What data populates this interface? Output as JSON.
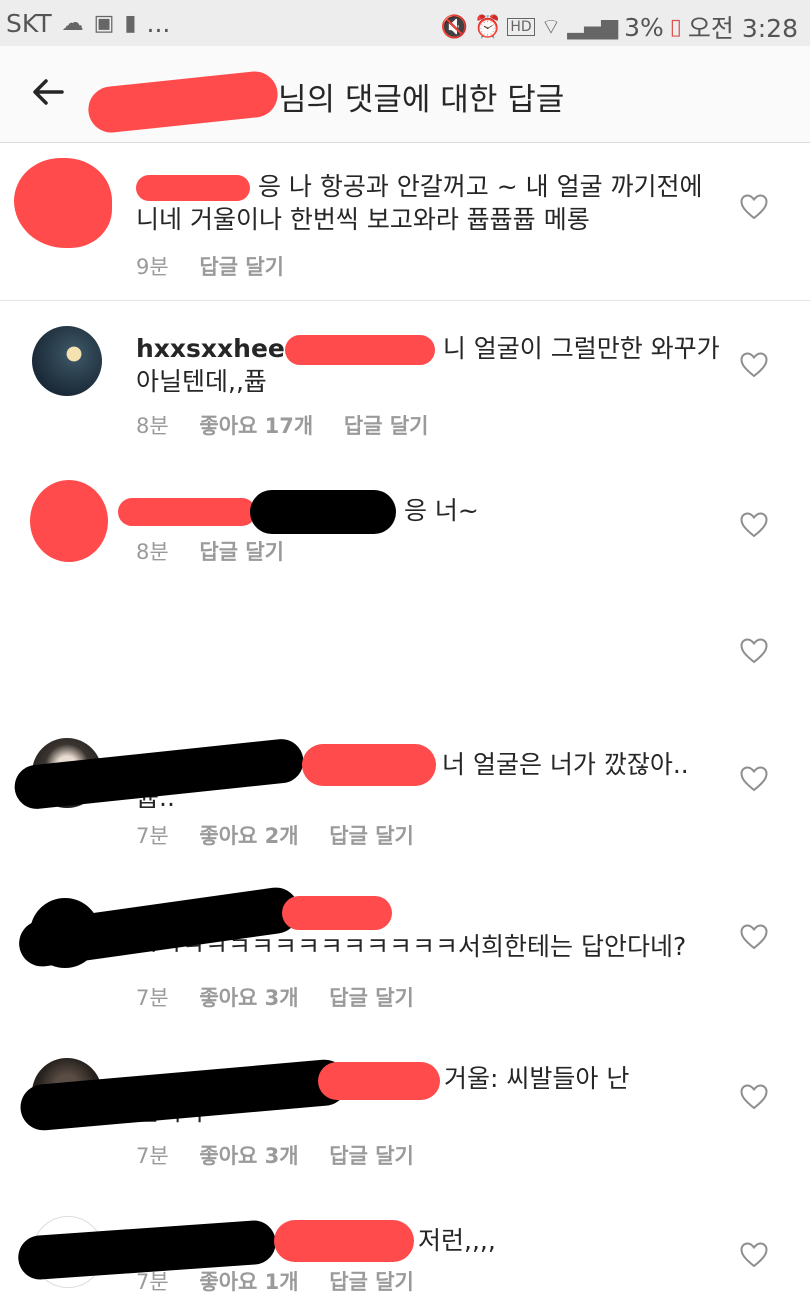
{
  "status_bar": {
    "carrier": "SKT",
    "dots": "...",
    "battery": "3%",
    "time_label": "오전 3:28"
  },
  "header": {
    "title_suffix": "님의 댓글에 대한 답글"
  },
  "comments": [
    {
      "text_line1": "응 나 항공과 안갈꺼고 ~ 내 얼굴 까기전에",
      "text_line2": "니네 거울이나 한번씩 보고와라 퓹퓹퓹 메롱",
      "time": "9분",
      "reply": "답글 달기"
    },
    {
      "username": "hxxsxxhee",
      "text_line1": "니 얼굴이 그럴만한 와꾸가",
      "text_line2": "아닐텐데,,퓹",
      "time": "8분",
      "likes": "좋아요 17개",
      "reply": "답글 달기"
    },
    {
      "text_line1": "응 너~",
      "time": "8분",
      "reply": "답글 달기"
    },
    {
      "text_line1": "너 얼굴은 너가 깠잖아..",
      "text_line2": "퓹..",
      "time": "7분",
      "likes": "좋아요 2개",
      "reply": "답글 달기"
    },
    {
      "text_line1": "ㅋㅋㅋㅋㅋㅋㅋㅋㅋㅋㅋㅋㅋㅋ서희한테는 답안다네?",
      "time": "7분",
      "likes": "좋아요 3개",
      "reply": "답글 달기"
    },
    {
      "text_line1": "거울: 씨발들아 난",
      "text_line2": "뭔죄야",
      "time": "7분",
      "likes": "좋아요 3개",
      "reply": "답글 달기"
    },
    {
      "text_line1": "저런,,,,",
      "time": "7분",
      "likes": "좋아요 1개",
      "reply": "답글 달기"
    }
  ],
  "colors": {
    "redaction_red": "#ff4b4b",
    "meta_gray": "#9a9a9a"
  }
}
